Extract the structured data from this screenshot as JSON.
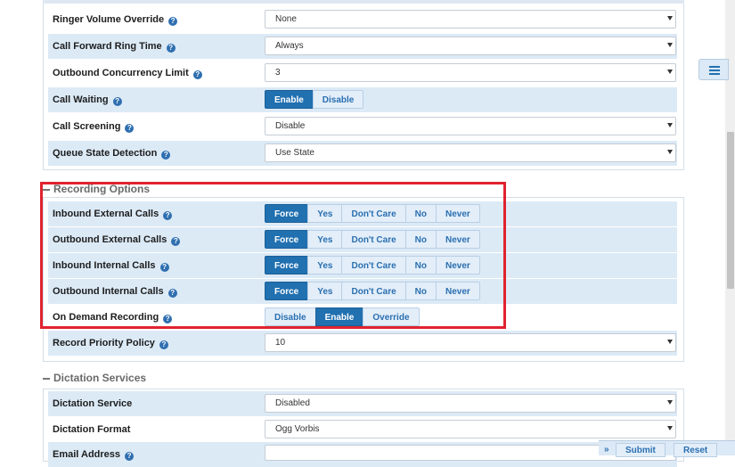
{
  "call_settings": [
    {
      "label": "Ringer Volume Override",
      "type": "select",
      "value": "None"
    },
    {
      "label": "Call Forward Ring Time",
      "type": "select",
      "value": "Always"
    },
    {
      "label": "Outbound Concurrency Limit",
      "type": "select",
      "value": "3"
    },
    {
      "label": "Call Waiting",
      "type": "toggle",
      "options": [
        "Enable",
        "Disable"
      ],
      "selected": "Enable"
    },
    {
      "label": "Call Screening",
      "type": "select",
      "value": "Disable"
    },
    {
      "label": "Queue State Detection",
      "type": "select",
      "value": "Use State"
    }
  ],
  "recording": {
    "title": "Recording Options",
    "options5": [
      "Force",
      "Yes",
      "Don't Care",
      "No",
      "Never"
    ],
    "rows": [
      {
        "label": "Inbound External Calls",
        "selected": "Force"
      },
      {
        "label": "Outbound External Calls",
        "selected": "Force"
      },
      {
        "label": "Inbound Internal Calls",
        "selected": "Force"
      },
      {
        "label": "Outbound Internal Calls",
        "selected": "Force"
      }
    ],
    "on_demand": {
      "label": "On Demand Recording",
      "options": [
        "Disable",
        "Enable",
        "Override"
      ],
      "selected": "Enable"
    },
    "priority": {
      "label": "Record Priority Policy",
      "value": "10"
    }
  },
  "dictation": {
    "title": "Dictation Services",
    "rows": [
      {
        "label": "Dictation Service",
        "value": "Disabled"
      },
      {
        "label": "Dictation Format",
        "value": "Ogg Vorbis"
      },
      {
        "label": "Email Address",
        "value": ""
      }
    ]
  },
  "footer": {
    "chevron": "»",
    "submit": "Submit",
    "reset": "Reset"
  },
  "colors": {
    "accent": "#2170b0",
    "highlight": "#e0232e",
    "row_shade": "#dceaf6"
  }
}
